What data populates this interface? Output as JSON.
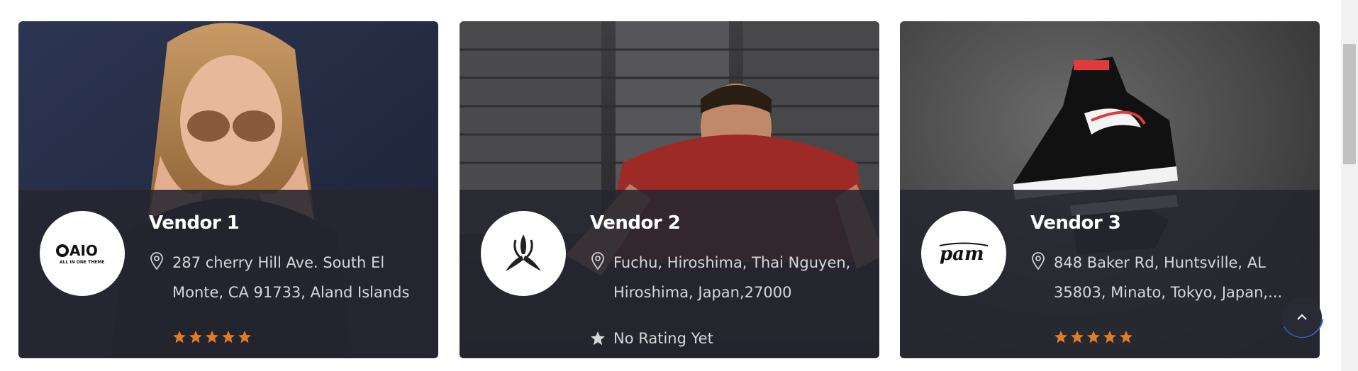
{
  "vendors": [
    {
      "name": "Vendor 1",
      "address": "287 cherry Hill Ave. South El Monte, CA 91733, Aland Islands",
      "rating_stars": 5,
      "logo_text": "AIO",
      "logo_subtext": "ALL IN ONE THEME",
      "photo": "woman-sunglasses"
    },
    {
      "name": "Vendor 2",
      "address": "Fuchu, Hiroshima, Thai Nguyen, Hiroshima, Japan,27000",
      "rating_text": "No Rating Yet",
      "logo": "tri-blade-symbol",
      "photo": "man-pushup"
    },
    {
      "name": "Vendor 3",
      "address": "848 Baker Rd, Huntsville, AL 35803, Minato, Tokyo, Japan,...",
      "rating_stars": 5,
      "logo_text": "pam",
      "photo": "sneakers"
    }
  ],
  "colors": {
    "overlay": "#262630",
    "star": "#e07b2a",
    "accent_ring": "#2f6fd6"
  },
  "icons": {
    "address": "map-pin-icon",
    "rating": "star-icon",
    "back_to_top": "chevron-up-icon"
  }
}
